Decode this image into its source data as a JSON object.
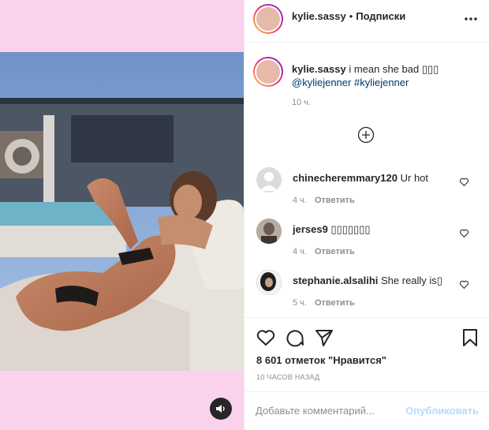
{
  "colors": {
    "media_background": "#fad2ec",
    "link": "#00376b",
    "muted": "#8e8e8e",
    "publish_disabled": "#b3dbff"
  },
  "header": {
    "username": "kylie.sassy",
    "separator": "•",
    "follow_label": "Подписки",
    "more_icon": "more-horizontal-icon"
  },
  "caption": {
    "username": "kylie.sassy",
    "text": "i mean she bad ▯▯▯",
    "tag1": "@kyliejenner",
    "tag2": "#kyliejenner",
    "time": "10 ч."
  },
  "load_more_icon": "plus-circle-icon",
  "comments": [
    {
      "username": "chinecheremmary120",
      "text": "Ur hot",
      "time": "4 ч.",
      "reply_label": "Ответить"
    },
    {
      "username": "jerses9",
      "text": "▯▯▯▯▯▯▯",
      "time": "4 ч.",
      "reply_label": "Ответить"
    },
    {
      "username": "stephanie.alsalihi",
      "text": "She really is▯",
      "time": "5 ч.",
      "reply_label": "Ответить"
    }
  ],
  "actions": {
    "icons": [
      "heart-icon",
      "comment-icon",
      "share-icon",
      "bookmark-icon"
    ],
    "likes": "8 601 отметок \"Нравится\"",
    "posted": "10 ЧАСОВ НАЗАД"
  },
  "comment_bar": {
    "placeholder": "Добавьте комментарий...",
    "publish_label": "Опубликовать"
  },
  "media": {
    "sound_icon": "speaker-icon"
  }
}
